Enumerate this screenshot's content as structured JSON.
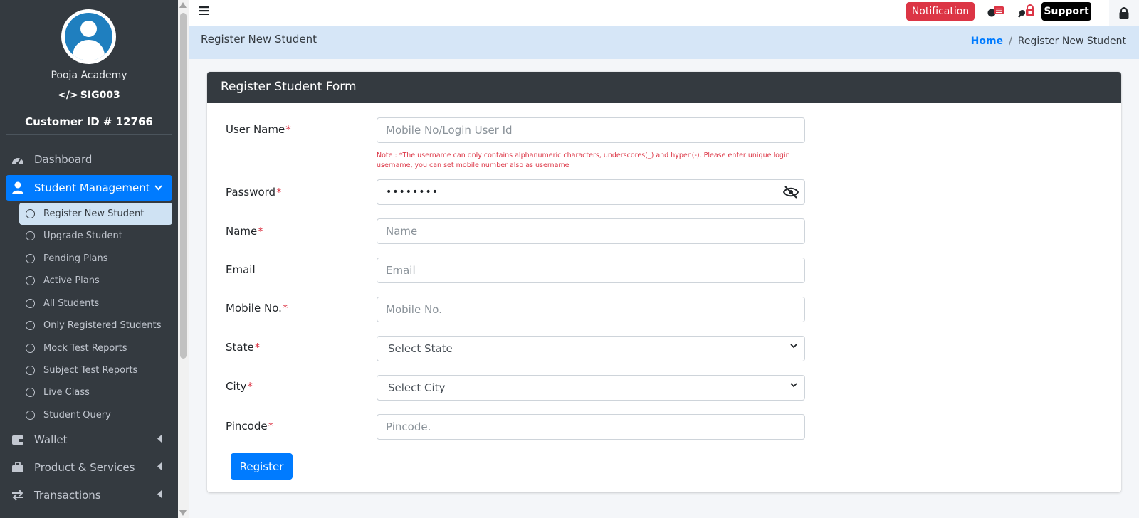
{
  "sidebar": {
    "org_name": "Pooja Academy",
    "org_code": "SIG003",
    "customer_id": "Customer ID # 12766",
    "nav": [
      {
        "label": "Dashboard",
        "icon": "dashboard-icon"
      },
      {
        "label": "Student Management",
        "icon": "user-icon",
        "active": true
      },
      {
        "label": "Wallet",
        "icon": "wallet-icon"
      },
      {
        "label": "Product & Services",
        "icon": "briefcase-icon"
      },
      {
        "label": "Transactions",
        "icon": "exchange-icon"
      }
    ],
    "sub_items": [
      {
        "label": "Register New Student",
        "active": true
      },
      {
        "label": "Upgrade Student"
      },
      {
        "label": "Pending Plans"
      },
      {
        "label": "Active Plans"
      },
      {
        "label": "All Students"
      },
      {
        "label": "Only Registered Students"
      },
      {
        "label": "Mock Test Reports"
      },
      {
        "label": "Subject Test Reports"
      },
      {
        "label": "Live Class"
      },
      {
        "label": "Student Query"
      }
    ]
  },
  "topbar": {
    "notification_label": "Notification",
    "support_label": "Support"
  },
  "header": {
    "title": "Register New Student",
    "breadcrumb_home": "Home",
    "breadcrumb_sep": "/",
    "breadcrumb_current": "Register New Student"
  },
  "form": {
    "title": "Register Student Form",
    "username_label": "User Name",
    "username_placeholder": "Mobile No/Login User Id",
    "note": "Note : *The username can only contains alphanumeric characters, underscores(_) and hypen(-). Please enter unique login username, you can set mobile number also as username",
    "password_label": "Password",
    "password_value": "••••••••",
    "name_label": "Name",
    "name_placeholder": "Name",
    "email_label": "Email",
    "email_placeholder": "Email",
    "mobile_label": "Mobile No.",
    "mobile_placeholder": "Mobile No.",
    "state_label": "State",
    "state_value": "Select State",
    "city_label": "City",
    "city_value": "Select City",
    "pincode_label": "Pincode",
    "pincode_placeholder": "Pincode.",
    "required_mark": "*",
    "submit_label": "Register"
  },
  "colors": {
    "sidebar_bg": "#343a40",
    "primary": "#007bff",
    "danger": "#dc3545",
    "header_bg": "#d6e6f7"
  }
}
